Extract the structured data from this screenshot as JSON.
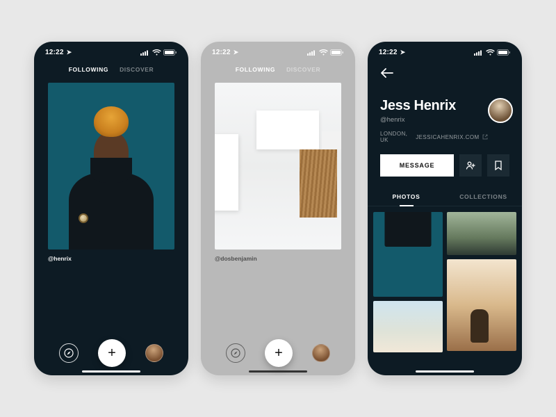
{
  "status": {
    "time": "12:22"
  },
  "feed": {
    "tabs": {
      "following": "FOLLOWING",
      "discover": "DISCOVER",
      "active": "following"
    }
  },
  "screen1": {
    "author_handle": "@henrix"
  },
  "screen2": {
    "author_handle": "@dosbenjamin"
  },
  "profile": {
    "name": "Jess Henrix",
    "handle": "@henrix",
    "location": "LONDON, UK",
    "website": "JESSICAHENRIX.COM",
    "actions": {
      "message": "MESSAGE"
    },
    "tabs": {
      "photos": "PHOTOS",
      "collections": "COLLECTIONS",
      "active": "photos"
    }
  }
}
